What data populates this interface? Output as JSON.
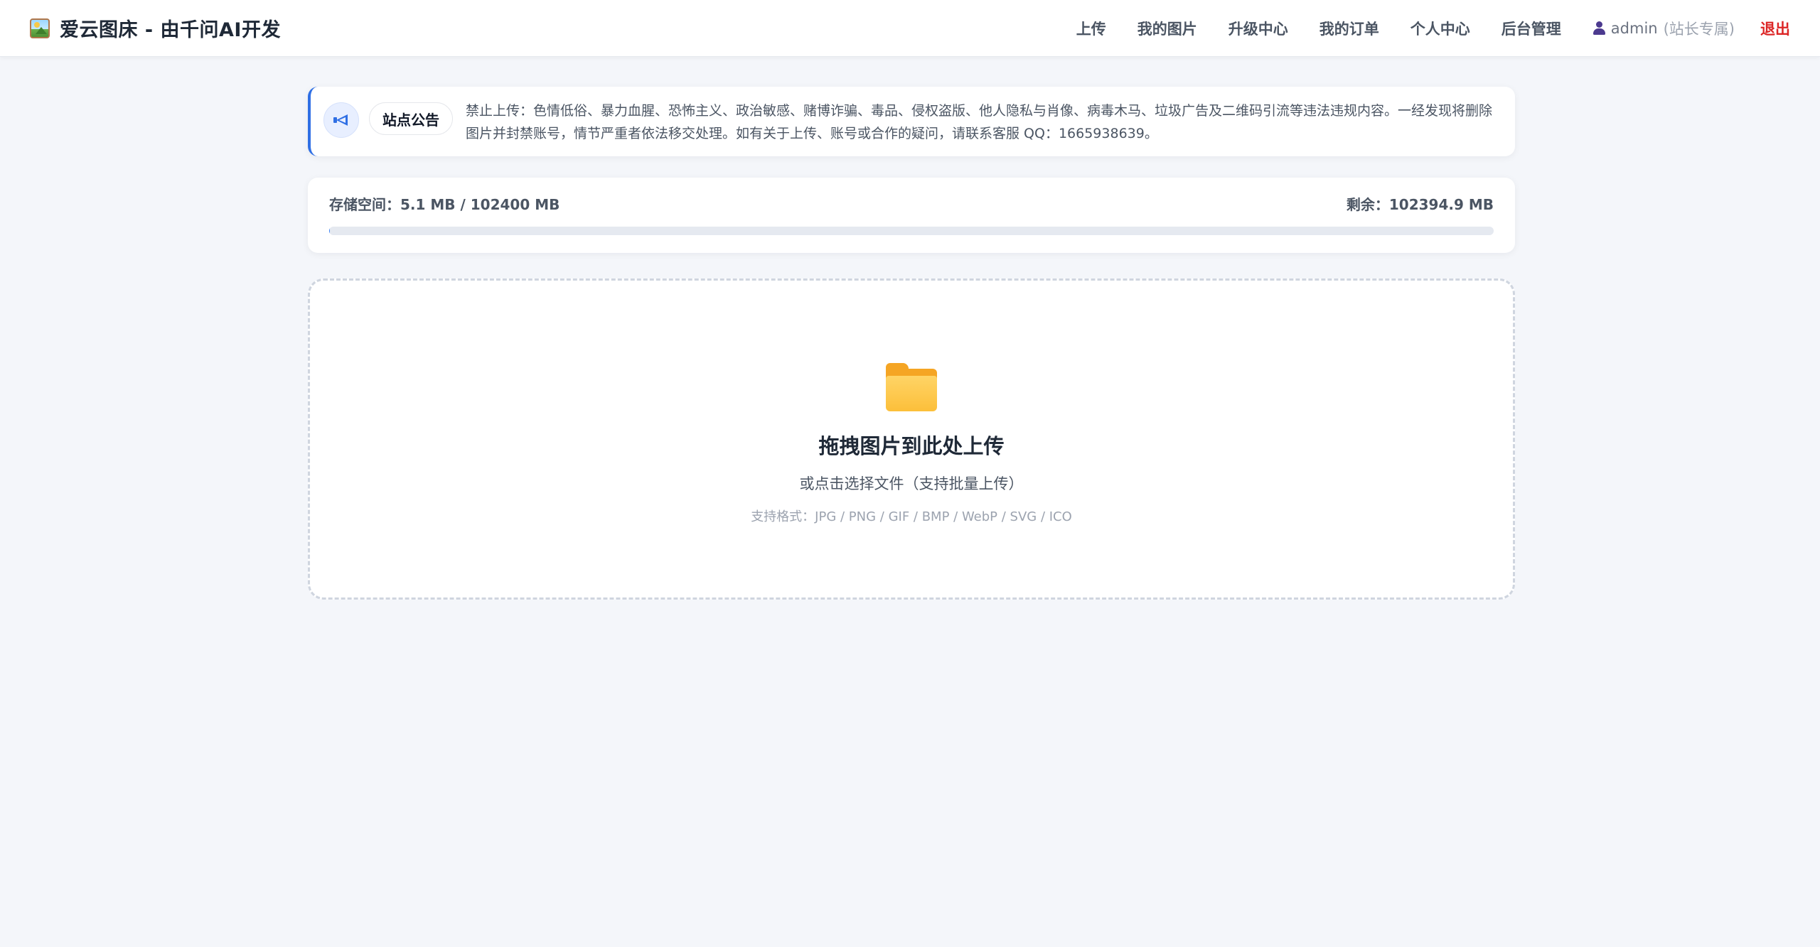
{
  "header": {
    "brand_title": "爱云图床 - 由千问AI开发",
    "nav": [
      {
        "label": "上传"
      },
      {
        "label": "我的图片"
      },
      {
        "label": "升级中心"
      },
      {
        "label": "我的订单"
      },
      {
        "label": "个人中心"
      },
      {
        "label": "后台管理"
      }
    ],
    "user": {
      "name": "admin",
      "role": "(站长专属)"
    },
    "logout_label": "退出"
  },
  "notice": {
    "badge": "站点公告",
    "text": "禁止上传：色情低俗、暴力血腥、恐怖主义、政治敏感、赌博诈骗、毒品、侵权盗版、他人隐私与肖像、病毒木马、垃圾广告及二维码引流等违法违规内容。一经发现将删除图片并封禁账号，情节严重者依法移交处理。如有关于上传、账号或合作的疑问，请联系客服 QQ：1665938639。"
  },
  "storage": {
    "used_label": "存储空间：5.1 MB / 102400 MB",
    "remaining_label": "剩余：102394.9 MB",
    "used_mb": 5.1,
    "total_mb": 102400
  },
  "upload": {
    "title": "拖拽图片到此处上传",
    "subtitle": "或点击选择文件（支持批量上传）",
    "formats": "支持格式：JPG / PNG / GIF / BMP / WebP / SVG / ICO"
  },
  "colors": {
    "accent": "#2f6fe4",
    "logout": "#dc2626",
    "background": "#f4f6fa"
  }
}
